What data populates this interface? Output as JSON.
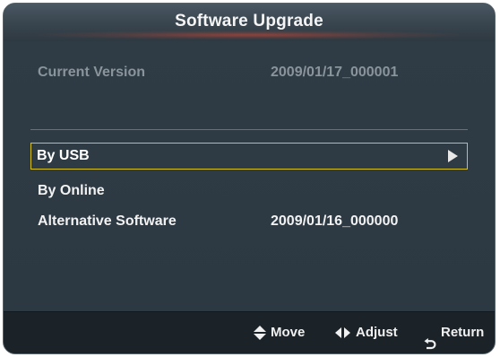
{
  "dialog": {
    "title": "Software Upgrade"
  },
  "info": {
    "current_version_label": "Current Version",
    "current_version_value": "2009/01/17_000001"
  },
  "menu": {
    "items": [
      {
        "label": "By USB",
        "value": "",
        "selected": true,
        "icon": "triangle-right-icon"
      },
      {
        "label": "By Online",
        "value": "",
        "selected": false
      },
      {
        "label": "Alternative Software",
        "value": "2009/01/16_000000",
        "selected": false
      }
    ]
  },
  "footer": {
    "move_label": "Move",
    "adjust_label": "Adjust",
    "return_label": "Return"
  },
  "colors": {
    "panel_background": "#2d3a44",
    "selection_border": "#d9c21b",
    "dim_text": "#8a949b",
    "footer_background": "#1c2328"
  }
}
